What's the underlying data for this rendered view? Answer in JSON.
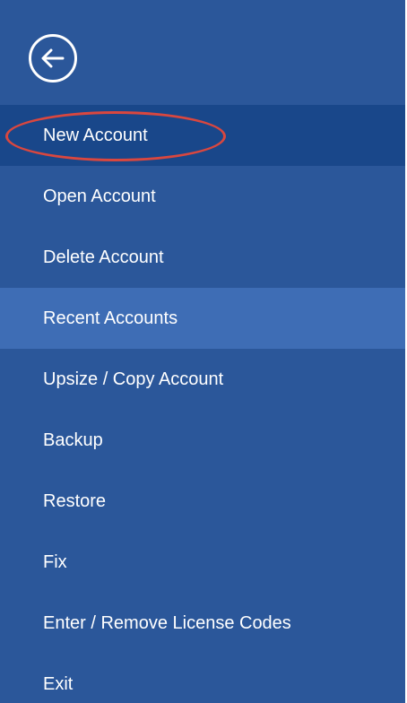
{
  "colors": {
    "panel_background": "#2b579a",
    "selected_item": "#19478a",
    "hover_item": "#3e6db5",
    "annotation_ellipse": "#d9473f",
    "text": "#ffffff"
  },
  "back_button": {
    "icon": "arrow-left-circle-icon"
  },
  "menu": {
    "selected_index": 0,
    "hover_index": 3,
    "items": [
      {
        "label": "New Account"
      },
      {
        "label": "Open Account"
      },
      {
        "label": "Delete Account"
      },
      {
        "label": "Recent Accounts"
      },
      {
        "label": "Upsize / Copy Account"
      },
      {
        "label": "Backup"
      },
      {
        "label": "Restore"
      },
      {
        "label": "Fix"
      },
      {
        "label": "Enter / Remove License Codes"
      },
      {
        "label": "Exit"
      }
    ]
  }
}
